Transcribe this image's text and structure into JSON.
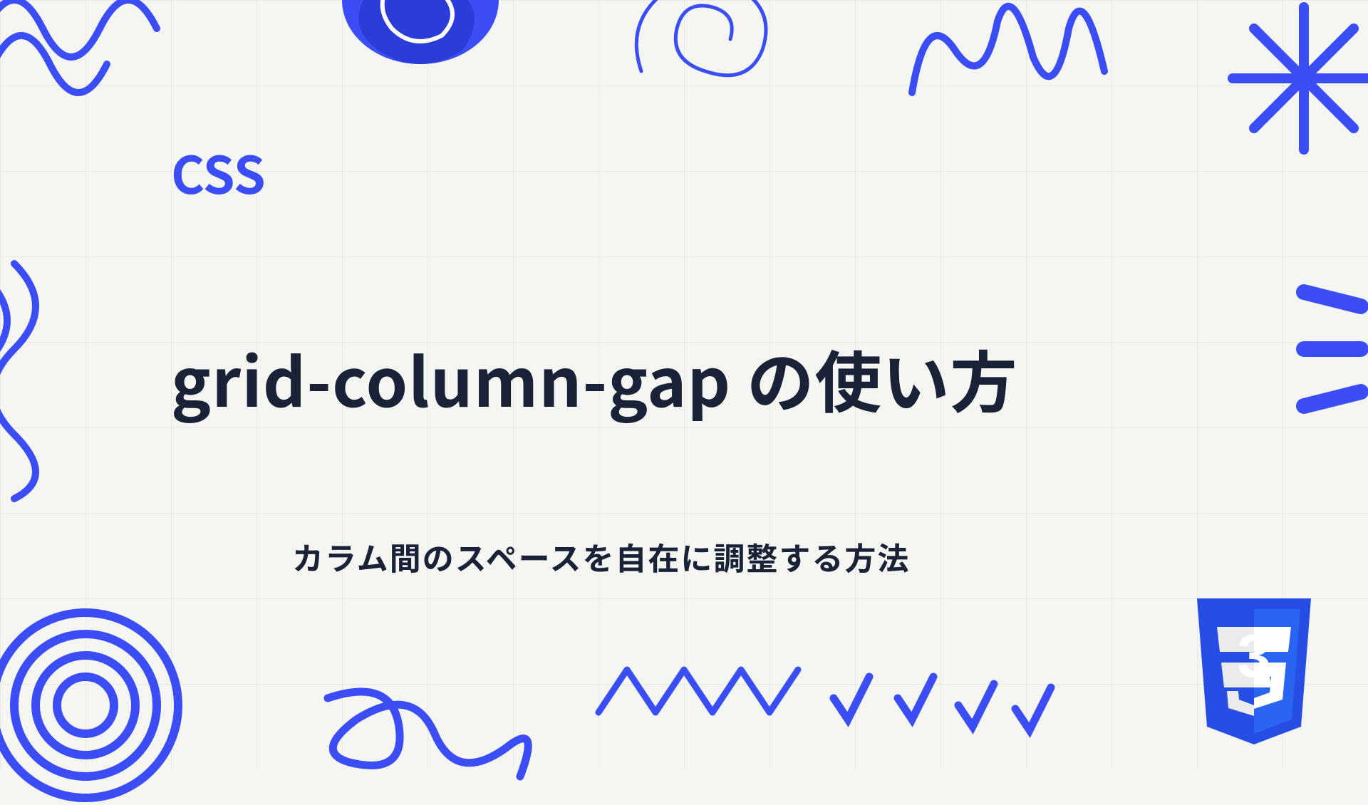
{
  "category": "CSS",
  "title": "grid-column-gap の使い方",
  "subtitle": "カラム間のスペースを自在に調整する方法",
  "badge_text": "3",
  "colors": {
    "accent": "#3b4ef5",
    "text": "#1a2238",
    "bg": "#f5f5f2"
  }
}
